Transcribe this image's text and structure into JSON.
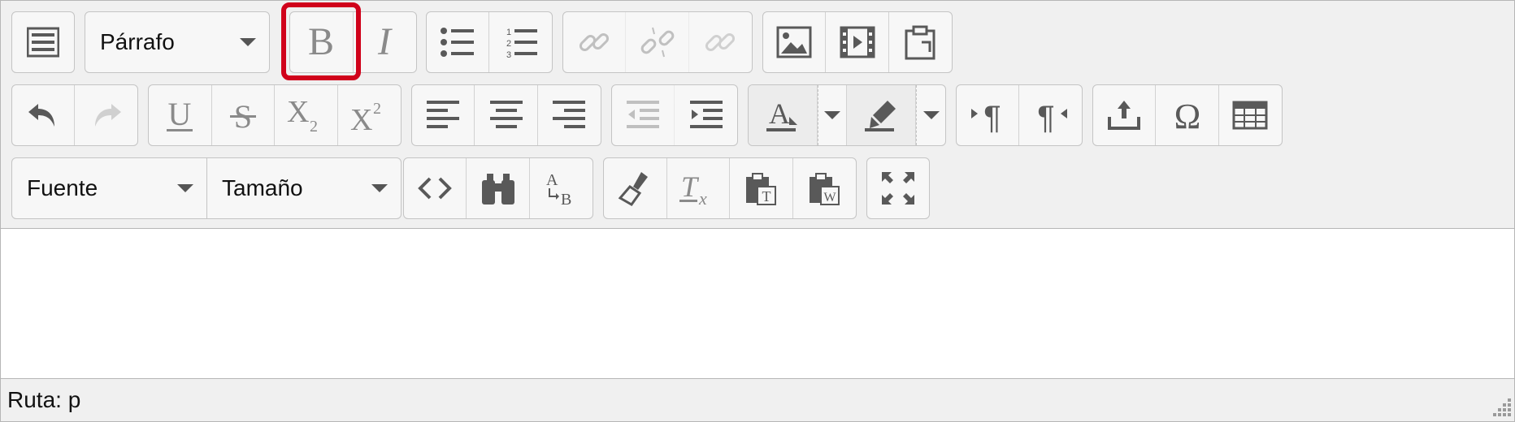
{
  "toolbar": {
    "paragraph_select": "Párrafo",
    "font_select": "Fuente",
    "size_select": "Tamaño"
  },
  "status": {
    "path_label": "Ruta: p"
  },
  "colors": {
    "toolbar_bg": "#f0f0f0",
    "button_bg": "#f7f7f7",
    "border": "#c4c4c4",
    "icon": "#595959",
    "highlight": "#d0021b"
  }
}
